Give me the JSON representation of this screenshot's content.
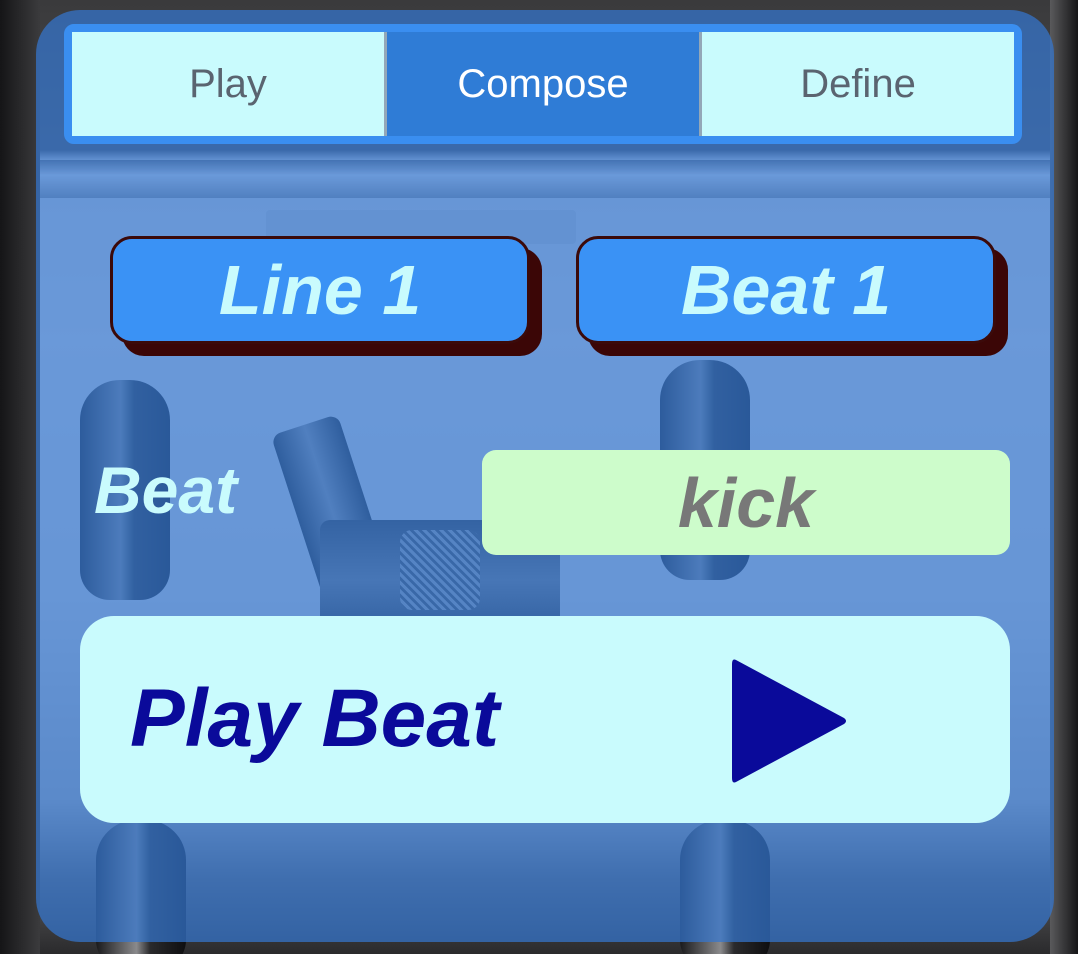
{
  "tabs": [
    {
      "label": "Play",
      "active": false
    },
    {
      "label": "Compose",
      "active": true
    },
    {
      "label": "Define",
      "active": false
    }
  ],
  "selectors": {
    "line_label": "Line 1",
    "beat_label": "Beat 1"
  },
  "beat_row": {
    "label": "Beat",
    "value": "kick"
  },
  "play_button": {
    "label": "Play Beat",
    "icon": "play-icon"
  },
  "colors": {
    "panel": "#3476ce",
    "tab_active": "#2f7cd6",
    "tab_inactive": "#c9fbfd",
    "selector_button": "#3a92f5",
    "beat_value_bg": "#cdfccb",
    "play_button_bg": "#c9fbfd",
    "play_accent": "#0a0a9a"
  }
}
